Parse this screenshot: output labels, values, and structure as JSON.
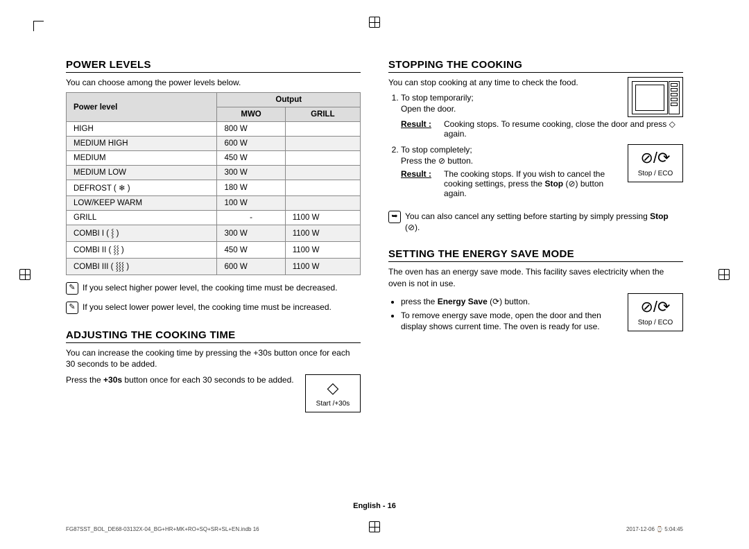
{
  "left": {
    "h1": "POWER LEVELS",
    "intro": "You can choose among the power levels below.",
    "table": {
      "head_power": "Power level",
      "head_output": "Output",
      "head_mwo": "MWO",
      "head_grill": "GRILL",
      "rows": [
        {
          "name": "HIGH",
          "mwo": "800 W",
          "grill": ""
        },
        {
          "name": "MEDIUM HIGH",
          "mwo": "600 W",
          "grill": ""
        },
        {
          "name": "MEDIUM",
          "mwo": "450 W",
          "grill": ""
        },
        {
          "name": "MEDIUM LOW",
          "mwo": "300 W",
          "grill": ""
        },
        {
          "name": "DEFROST ( ❄ )",
          "mwo": "180 W",
          "grill": ""
        },
        {
          "name": "LOW/KEEP WARM",
          "mwo": "100 W",
          "grill": ""
        },
        {
          "name": "GRILL",
          "mwo": "-",
          "grill": "1100 W"
        },
        {
          "name": "COMBI I ( ⸾ )",
          "mwo": "300 W",
          "grill": "1100 W"
        },
        {
          "name": "COMBI II ( ⸾⸾ )",
          "mwo": "450 W",
          "grill": "1100 W"
        },
        {
          "name": "COMBI III ( ⸾⸾⸾ )",
          "mwo": "600 W",
          "grill": "1100 W"
        }
      ]
    },
    "note1": "If you select higher power level, the cooking time must be decreased.",
    "note2": "If you select lower power level, the cooking time must be increased.",
    "h2": "ADJUSTING THE COOKING TIME",
    "adj_p1": "You can increase the cooking time by pressing the +30s button once for each 30 seconds to be added.",
    "adj_p2_pre": "Press the ",
    "adj_p2_bold": "+30s",
    "adj_p2_post": " button once for each 30 seconds to be added.",
    "btn_start": "Start /+30s"
  },
  "right": {
    "h1": "STOPPING THE COOKING",
    "intro": "You can stop cooking at any time to check the food.",
    "li1a": "To stop temporarily;",
    "li1b": "Open the door.",
    "res": "Result :",
    "res1": "Cooking stops. To resume cooking, close the door and press ◇ again.",
    "li2a": "To stop completely;",
    "li2b": "Press the ⊘ button.",
    "res2": "The cooking stops. If you wish to cancel the cooking settings, press the ",
    "res2b": "Stop",
    "res2c": " (⊘) button again.",
    "note3a": "You can also cancel any setting before starting by simply pressing ",
    "note3b": "Stop",
    "note3c": " (⊘).",
    "btn_stop": "Stop / ECO",
    "h2": "SETTING THE ENERGY SAVE MODE",
    "es_intro": "The oven has an energy save mode. This facility saves electricity when the oven is not in use.",
    "es_b1a": "press the ",
    "es_b1b": "Energy Save",
    "es_b1c": " (⟳) button.",
    "es_b2": "To remove energy save mode, open the door and then display shows current time. The oven is ready for use."
  },
  "footer": "English - 16",
  "meta_left": "FG87SST_BOL_DE68-03132X-04_BG+HR+MK+RO+SQ+SR+SL+EN.indb   16",
  "meta_right": "2017-12-06   ⌚ 5:04:45",
  "icons": {
    "diamond": "◇",
    "stopeco": "⊘/⟳"
  }
}
